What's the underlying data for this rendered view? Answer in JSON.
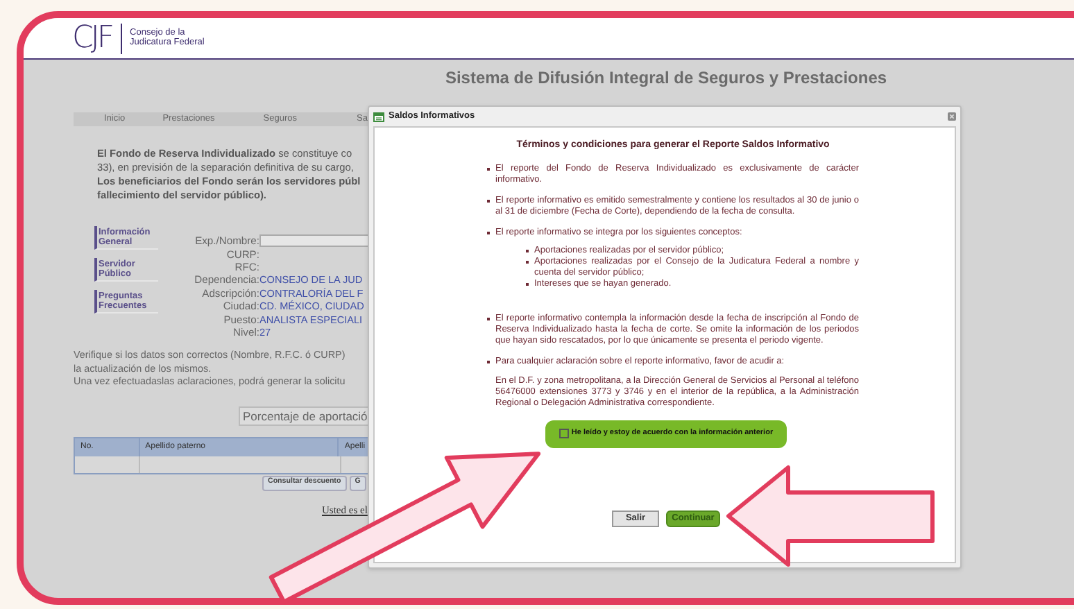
{
  "header": {
    "logo_mark": "CJF",
    "logo_text": [
      "Consejo de la",
      "Judicatura Federal"
    ]
  },
  "page_title": "Sistema de Difusión Integral de Seguros y Prestaciones",
  "nav": [
    {
      "label": "Inicio"
    },
    {
      "label": "Prestaciones"
    },
    {
      "label": "Seguros"
    },
    {
      "label": "Sa"
    }
  ],
  "intro_lines": [
    "**El Fondo de Reserva Individualizado** se constituye co",
    "33), en previsión de la separación definitiva de su cargo,",
    "**Los beneficiarios del Fondo serán los servidores públ**",
    "**fallecimiento del servidor público).**"
  ],
  "side_links": [
    {
      "label": "Información General"
    },
    {
      "label": "Servidor Público"
    },
    {
      "label": "Preguntas Frecuentes"
    }
  ],
  "form": [
    {
      "label": "Exp./Nombre:",
      "kind": "input"
    },
    {
      "label": "CURP:",
      "kind": "text"
    },
    {
      "label": "RFC:",
      "kind": "text"
    },
    {
      "label": "Dependencia:",
      "kind": "text",
      "value": "CONSEJO DE LA JUD"
    },
    {
      "label": "Adscripción:",
      "kind": "text",
      "value": "CONTRALORÍA DEL F"
    },
    {
      "label": "Ciudad:",
      "kind": "text",
      "value": "CD. MÉXICO, CIUDAD"
    },
    {
      "label": "Puesto:",
      "kind": "text",
      "value": "ANALISTA ESPECIALI"
    },
    {
      "label": "Nivel:",
      "kind": "text",
      "value": "27"
    }
  ],
  "verify_lines": [
    "Verifique si los datos son correctos (Nombre, R.F.C. ó CURP)",
    "la actualización de los mismos.",
    "Una vez efectuadaslas aclaraciones, podrá generar la solicitu"
  ],
  "percentage_label": "Porcentaje de aportació",
  "table": {
    "columns": [
      "No.",
      "Apellido paterno",
      "Apelli"
    ]
  },
  "buttons": [
    "Consultar descuento",
    "G"
  ],
  "footer_link": "Usted es el",
  "dialog": {
    "title": "Saldos Informativos",
    "heading": "Términos y condiciones para generar el Reporte Saldos Informativo",
    "items": [
      {
        "kind": "bullet",
        "text": "El reporte del Fondo de Reserva Individualizado es exclusivamente de carácter informativo."
      },
      {
        "kind": "bullet",
        "text": "El reporte informativo es emitido semestralmente y contiene los resultados al 30 de junio o al 31 de diciembre (Fecha de Corte), dependiendo de la fecha de consulta."
      },
      {
        "kind": "bullet",
        "text": "El reporte informativo se integra por los siguientes conceptos:"
      },
      {
        "kind": "sublist",
        "items": [
          "Aportaciones realizadas por el servidor público;",
          "Aportaciones realizadas por el Consejo de la Judicatura Federal a nombre y cuenta del servidor público;",
          "Intereses que se hayan generado."
        ]
      },
      {
        "kind": "bullet",
        "text": "El reporte informativo contempla la información desde la fecha de inscripción al Fondo de Reserva Individualizado hasta la fecha de corte. Se omite la información de los periodos que hayan sido rescatados, por lo que únicamente se presenta el periodo vigente."
      },
      {
        "kind": "bullet",
        "text": "Para cualquier aclaración sobre el reporte informativo, favor de acudir a:"
      },
      {
        "kind": "note",
        "text": "En el D.F. y zona metropolitana, a la Dirección General de Servicios al Personal al teléfono 56476000 extensiones 3773 y 3746 y en el interior de la república, a la Administración Regional o Delegación Administrativa correspondiente."
      }
    ],
    "agree": {
      "label": "He leído y estoy de acuerdo con la información anterior",
      "checked": false
    },
    "buttons": [
      {
        "label": "Salir",
        "kind": "secondary"
      },
      {
        "label": "Continuar",
        "kind": "primary"
      }
    ]
  }
}
